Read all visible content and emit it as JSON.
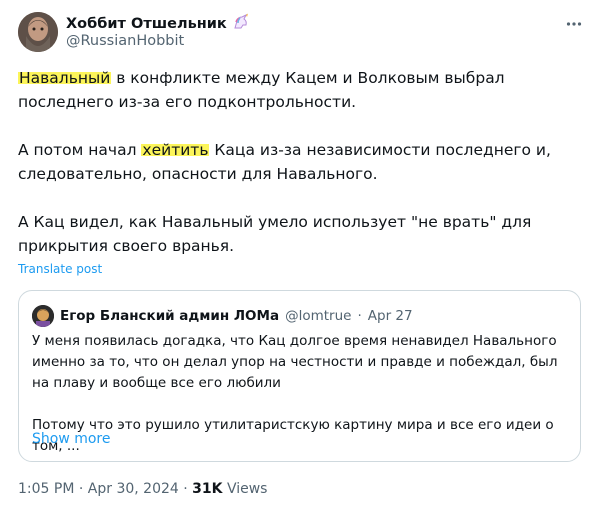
{
  "author": {
    "display_name": "Хоббит Отшельник",
    "handle": "@RussianHobbit"
  },
  "tweet": {
    "p1_highlight": "Навальный",
    "p1_rest": " в конфликте между Кацем и Волковым выбрал последнего из-за его подконтрольности.",
    "p2_before": "А потом начал ",
    "p2_highlight": "хейтить",
    "p2_after": " Каца из-за независимости последнего и, следовательно, опасности для Навального.",
    "p3": "А Кац видел, как Навальный умело использует \"не врать\" для прикрытия своего вранья."
  },
  "translate_label": "Translate post",
  "quote": {
    "display_name": "Егор Бланский админ ЛОМа",
    "handle": "@lomtrue",
    "separator": "·",
    "date": "Apr 27",
    "p1": "У меня появилась догадка, что Кац долгое время ненавидел Навального именно за то, что он делал упор на честности и правде и побеждал, был на плаву и вообще все его любили",
    "p2": "Потому что это рушило утилитаристскую картину мира и все его идеи о том, ...",
    "show_more": "Show more"
  },
  "footer": {
    "time": "1:05 PM",
    "sep1": " · ",
    "date": "Apr 30, 2024",
    "sep2": " · ",
    "views_count": "31K",
    "views_label": " Views"
  },
  "colors": {
    "link": "#1d9bf0",
    "highlight": "#fcf55a",
    "muted": "#536471"
  },
  "icons": {
    "author_badge": "unicorn-icon",
    "more": "more-horizontal-icon"
  }
}
